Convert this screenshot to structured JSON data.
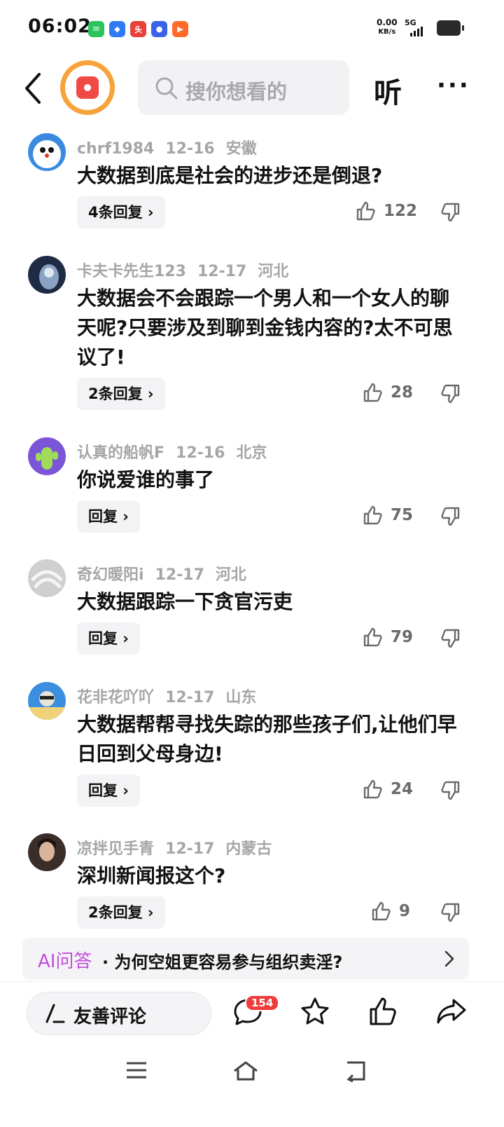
{
  "status_bar": {
    "time": "06:02",
    "net_speed": "0.00",
    "net_unit": "KB/s",
    "signal": "5G",
    "apps": [
      {
        "icon": "wechat-icon",
        "color": "#2bc45c",
        "glyph": "✉"
      },
      {
        "icon": "blue-app-icon",
        "color": "#2f7bf5",
        "glyph": "◆"
      },
      {
        "icon": "toutiao-icon",
        "color": "#e8403a",
        "glyph": "头"
      },
      {
        "icon": "baidu-icon",
        "color": "#3a63e8",
        "glyph": "●"
      },
      {
        "icon": "kuaishou-icon",
        "color": "#ff6a2b",
        "glyph": "▶"
      }
    ]
  },
  "header": {
    "search_placeholder": "搜你想看的",
    "listen_label": "听",
    "more_label": "···"
  },
  "comments": [
    {
      "user": "chrf1984",
      "date": "12-16",
      "location": "安徽",
      "text": "大数据到底是社会的进步还是倒退?",
      "replies": "4条回复",
      "likes": "122",
      "avatar_color": "#3a8be0"
    },
    {
      "user": "卡夫卡先生123",
      "date": "12-17",
      "location": "河北",
      "text": "大数据会不会跟踪一个男人和一个女人的聊天呢?只要涉及到聊到金钱内容的?太不可思议了!",
      "replies": "2条回复",
      "likes": "28",
      "avatar_color": "#1e2b44"
    },
    {
      "user": "认真的船帆F",
      "date": "12-16",
      "location": "北京",
      "text": "你说爱谁的事了",
      "replies": "回复",
      "likes": "75",
      "avatar_color": "#7a55d8"
    },
    {
      "user": "奇幻暖阳i",
      "date": "12-17",
      "location": "河北",
      "text": "大数据跟踪一下贪官污吏",
      "replies": "回复",
      "likes": "79",
      "avatar_color": "#cfcfcf"
    },
    {
      "user": "花非花吖吖",
      "date": "12-17",
      "location": "山东",
      "text": "大数据帮帮寻找失踪的那些孩子们,让他们早日回到父母身边!",
      "replies": "回复",
      "likes": "24",
      "avatar_color": "#3c8fe0"
    },
    {
      "user": "凉拌见手青",
      "date": "12-17",
      "location": "内蒙古",
      "text": "深圳新闻报这个?",
      "replies": "2条回复",
      "likes": "9",
      "avatar_color": "#3b2e2a"
    }
  ],
  "ai_bar": {
    "label": "AI问答",
    "question": "· 为何空姐更容易参与组织卖淫?"
  },
  "toolbar": {
    "comment_label": "友善评论",
    "comment_count": "154"
  }
}
